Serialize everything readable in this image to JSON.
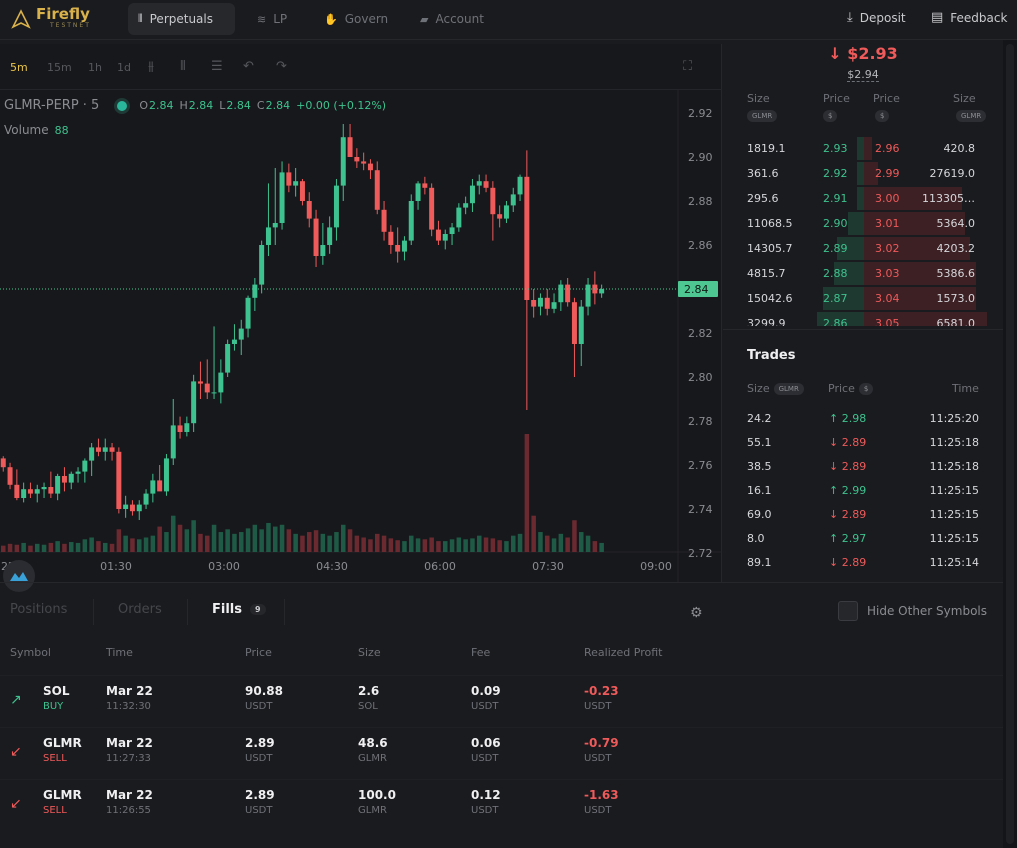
{
  "brand": {
    "name": "Firefly",
    "sub": "TESTNET"
  },
  "nav": {
    "items": [
      {
        "label": "Perpetuals",
        "icon": "candles-icon",
        "active": true
      },
      {
        "label": "LP",
        "icon": "waves-icon",
        "active": false
      },
      {
        "label": "Govern",
        "icon": "hand-vote-icon",
        "active": false
      },
      {
        "label": "Account",
        "icon": "wallet-icon",
        "active": false
      }
    ]
  },
  "top_right": {
    "deposit": "Deposit",
    "feedback": "Feedback"
  },
  "toolbar": {
    "timeframes": [
      "5m",
      "15m",
      "1h",
      "1d"
    ],
    "active_timeframe": "5m"
  },
  "legend": {
    "symbol": "GLMR-PERP · 5",
    "o_label": "O",
    "o": "2.84",
    "h_label": "H",
    "h": "2.84",
    "l_label": "L",
    "l": "2.84",
    "c_label": "C",
    "c": "2.84",
    "change": "+0.00 (+0.12%)",
    "volume_label": "Volume",
    "volume": "88"
  },
  "price_axis": {
    "ticks": [
      "2.92",
      "2.90",
      "2.88",
      "2.86",
      "2.84",
      "2.82",
      "2.80",
      "2.78",
      "2.76",
      "2.74",
      "2.72"
    ],
    "current_price": "2.84"
  },
  "time_axis": {
    "ticks": [
      "22",
      "01:30",
      "03:00",
      "04:30",
      "06:00",
      "07:30",
      "09:00"
    ]
  },
  "chart_data": {
    "type": "candlestick",
    "symbol": "GLMR-PERP",
    "interval": "5m",
    "ylim": [
      2.715,
      2.925
    ],
    "current_price": 2.84,
    "x_ticks": [
      "22",
      "01:30",
      "03:00",
      "04:30",
      "06:00",
      "07:30",
      "09:00"
    ],
    "y_ticks": [
      2.92,
      2.9,
      2.88,
      2.86,
      2.84,
      2.82,
      2.8,
      2.78,
      2.76,
      2.74,
      2.72
    ],
    "candles": [
      [
        2.763,
        2.764,
        2.757,
        2.759
      ],
      [
        2.759,
        2.761,
        2.749,
        2.751
      ],
      [
        2.751,
        2.758,
        2.744,
        2.745
      ],
      [
        2.745,
        2.752,
        2.743,
        2.749
      ],
      [
        2.749,
        2.752,
        2.745,
        2.747
      ],
      [
        2.747,
        2.751,
        2.743,
        2.749
      ],
      [
        2.749,
        2.752,
        2.745,
        2.75
      ],
      [
        2.75,
        2.757,
        2.745,
        2.747
      ],
      [
        2.747,
        2.756,
        2.744,
        2.755
      ],
      [
        2.755,
        2.759,
        2.748,
        2.752
      ],
      [
        2.752,
        2.757,
        2.749,
        2.756
      ],
      [
        2.756,
        2.759,
        2.752,
        2.757
      ],
      [
        2.757,
        2.763,
        2.752,
        2.762
      ],
      [
        2.762,
        2.77,
        2.755,
        2.768
      ],
      [
        2.768,
        2.772,
        2.764,
        2.766
      ],
      [
        2.766,
        2.772,
        2.762,
        2.768
      ],
      [
        2.768,
        2.77,
        2.762,
        2.766
      ],
      [
        2.766,
        2.768,
        2.738,
        2.74
      ],
      [
        2.74,
        2.746,
        2.736,
        2.742
      ],
      [
        2.742,
        2.744,
        2.737,
        2.739
      ],
      [
        2.739,
        2.744,
        2.735,
        2.742
      ],
      [
        2.742,
        2.749,
        2.74,
        2.747
      ],
      [
        2.747,
        2.756,
        2.743,
        2.753
      ],
      [
        2.753,
        2.76,
        2.75,
        2.748
      ],
      [
        2.748,
        2.765,
        2.746,
        2.763
      ],
      [
        2.763,
        2.79,
        2.76,
        2.778
      ],
      [
        2.778,
        2.782,
        2.772,
        2.775
      ],
      [
        2.775,
        2.782,
        2.773,
        2.779
      ],
      [
        2.779,
        2.801,
        2.775,
        2.798
      ],
      [
        2.798,
        2.807,
        2.79,
        2.797
      ],
      [
        2.797,
        2.808,
        2.79,
        2.793
      ],
      [
        2.793,
        2.823,
        2.79,
        2.793
      ],
      [
        2.793,
        2.808,
        2.788,
        2.802
      ],
      [
        2.802,
        2.817,
        2.8,
        2.815
      ],
      [
        2.815,
        2.824,
        2.812,
        2.817
      ],
      [
        2.817,
        2.826,
        2.81,
        2.822
      ],
      [
        2.822,
        2.837,
        2.818,
        2.836
      ],
      [
        2.836,
        2.845,
        2.83,
        2.842
      ],
      [
        2.842,
        2.862,
        2.838,
        2.86
      ],
      [
        2.86,
        2.888,
        2.855,
        2.868
      ],
      [
        2.868,
        2.895,
        2.86,
        2.87
      ],
      [
        2.87,
        2.898,
        2.867,
        2.893
      ],
      [
        2.893,
        2.897,
        2.884,
        2.887
      ],
      [
        2.887,
        2.895,
        2.882,
        2.889
      ],
      [
        2.889,
        2.89,
        2.878,
        2.88
      ],
      [
        2.88,
        2.884,
        2.868,
        2.872
      ],
      [
        2.872,
        2.876,
        2.85,
        2.855
      ],
      [
        2.855,
        2.87,
        2.851,
        2.86
      ],
      [
        2.86,
        2.873,
        2.856,
        2.868
      ],
      [
        2.868,
        2.89,
        2.862,
        2.887
      ],
      [
        2.887,
        2.915,
        2.88,
        2.909
      ],
      [
        2.909,
        2.915,
        2.902,
        2.9
      ],
      [
        2.9,
        2.904,
        2.895,
        2.898
      ],
      [
        2.898,
        2.902,
        2.894,
        2.897
      ],
      [
        2.897,
        2.899,
        2.89,
        2.894
      ],
      [
        2.894,
        2.898,
        2.874,
        2.876
      ],
      [
        2.876,
        2.88,
        2.862,
        2.866
      ],
      [
        2.866,
        2.869,
        2.856,
        2.86
      ],
      [
        2.86,
        2.868,
        2.852,
        2.857
      ],
      [
        2.857,
        2.864,
        2.853,
        2.862
      ],
      [
        2.862,
        2.883,
        2.86,
        2.88
      ],
      [
        2.88,
        2.889,
        2.876,
        2.888
      ],
      [
        2.888,
        2.891,
        2.883,
        2.886
      ],
      [
        2.886,
        2.888,
        2.864,
        2.867
      ],
      [
        2.867,
        2.871,
        2.86,
        2.862
      ],
      [
        2.862,
        2.867,
        2.858,
        2.865
      ],
      [
        2.865,
        2.87,
        2.86,
        2.868
      ],
      [
        2.868,
        2.879,
        2.866,
        2.877
      ],
      [
        2.877,
        2.882,
        2.874,
        2.879
      ],
      [
        2.879,
        2.89,
        2.875,
        2.887
      ],
      [
        2.887,
        2.892,
        2.883,
        2.889
      ],
      [
        2.889,
        2.892,
        2.884,
        2.886
      ],
      [
        2.886,
        2.889,
        2.862,
        2.874
      ],
      [
        2.874,
        2.878,
        2.868,
        2.872
      ],
      [
        2.872,
        2.88,
        2.87,
        2.878
      ],
      [
        2.878,
        2.886,
        2.875,
        2.883
      ],
      [
        2.883,
        2.892,
        2.88,
        2.891
      ],
      [
        2.891,
        2.903,
        2.785,
        2.835
      ],
      [
        2.835,
        2.84,
        2.827,
        2.832
      ],
      [
        2.832,
        2.838,
        2.828,
        2.836
      ],
      [
        2.836,
        2.84,
        2.828,
        2.831
      ],
      [
        2.831,
        2.838,
        2.829,
        2.834
      ],
      [
        2.834,
        2.844,
        2.83,
        2.842
      ],
      [
        2.842,
        2.845,
        2.832,
        2.834
      ],
      [
        2.834,
        2.836,
        2.8,
        2.815
      ],
      [
        2.815,
        2.835,
        2.805,
        2.832
      ],
      [
        2.832,
        2.845,
        2.828,
        2.842
      ],
      [
        2.842,
        2.848,
        2.833,
        2.838
      ],
      [
        2.838,
        2.842,
        2.836,
        2.84
      ]
    ],
    "volume": [
      7,
      9,
      8,
      10,
      7,
      9,
      8,
      10,
      12,
      9,
      11,
      10,
      14,
      16,
      12,
      10,
      9,
      25,
      18,
      15,
      14,
      16,
      18,
      28,
      22,
      40,
      30,
      25,
      35,
      20,
      18,
      30,
      22,
      25,
      20,
      22,
      26,
      30,
      25,
      32,
      28,
      30,
      25,
      20,
      18,
      22,
      24,
      20,
      18,
      22,
      30,
      25,
      18,
      16,
      14,
      20,
      18,
      15,
      13,
      12,
      18,
      15,
      14,
      16,
      12,
      12,
      14,
      16,
      14,
      15,
      18,
      16,
      15,
      13,
      12,
      18,
      20,
      130,
      40,
      22,
      18,
      15,
      20,
      16,
      35,
      22,
      18,
      12,
      10
    ]
  },
  "orderbook": {
    "mark_price": "$2.93",
    "index_price": "$2.94",
    "headers": {
      "size_left": "Size",
      "price_left": "Price",
      "price_right": "Price",
      "size_right": "Size",
      "pill_size_left": "GLMR",
      "pill_price_left": "$",
      "pill_price_right": "$",
      "pill_size_right": "GLMR"
    },
    "rows": [
      {
        "bid_size": "1819.1",
        "bid_price": "2.93",
        "ask_price": "2.96",
        "ask_size": "420.8",
        "bid_depth": 0.03,
        "ask_depth": 0.03
      },
      {
        "bid_size": "361.6",
        "bid_price": "2.92",
        "ask_price": "2.99",
        "ask_size": "27619.0",
        "bid_depth": 0.03,
        "ask_depth": 0.05
      },
      {
        "bid_size": "295.6",
        "bid_price": "2.91",
        "ask_price": "3.00",
        "ask_size": "113305…",
        "bid_depth": 0.03,
        "ask_depth": 0.35
      },
      {
        "bid_size": "11068.5",
        "bid_price": "2.90",
        "ask_price": "3.01",
        "ask_size": "5364.0",
        "bid_depth": 0.06,
        "ask_depth": 0.36
      },
      {
        "bid_size": "14305.7",
        "bid_price": "2.89",
        "ask_price": "3.02",
        "ask_size": "4203.2",
        "bid_depth": 0.1,
        "ask_depth": 0.38
      },
      {
        "bid_size": "4815.7",
        "bid_price": "2.88",
        "ask_price": "3.03",
        "ask_size": "5386.6",
        "bid_depth": 0.11,
        "ask_depth": 0.4
      },
      {
        "bid_size": "15042.6",
        "bid_price": "2.87",
        "ask_price": "3.04",
        "ask_size": "1573.0",
        "bid_depth": 0.15,
        "ask_depth": 0.4
      },
      {
        "bid_size": "3299.9",
        "bid_price": "2.86",
        "ask_price": "3.05",
        "ask_size": "6581.0",
        "bid_depth": 0.17,
        "ask_depth": 0.44
      }
    ]
  },
  "trades": {
    "title": "Trades",
    "headers": {
      "size": "Size",
      "size_unit": "GLMR",
      "price": "Price",
      "price_unit": "$",
      "time": "Time"
    },
    "rows": [
      {
        "size": "24.2",
        "price": "2.98",
        "dir": "up",
        "time": "11:25:20"
      },
      {
        "size": "55.1",
        "price": "2.89",
        "dir": "down",
        "time": "11:25:18"
      },
      {
        "size": "38.5",
        "price": "2.89",
        "dir": "down",
        "time": "11:25:18"
      },
      {
        "size": "16.1",
        "price": "2.99",
        "dir": "up",
        "time": "11:25:15"
      },
      {
        "size": "69.0",
        "price": "2.89",
        "dir": "down",
        "time": "11:25:15"
      },
      {
        "size": "8.0",
        "price": "2.97",
        "dir": "up",
        "time": "11:25:15"
      },
      {
        "size": "89.1",
        "price": "2.89",
        "dir": "down",
        "time": "11:25:14"
      }
    ]
  },
  "bottom": {
    "tabs": {
      "positions": "Positions",
      "orders": "Orders",
      "fills": "Fills",
      "fills_count": "9"
    },
    "hide_other_symbols": "Hide Other Symbols",
    "columns": {
      "symbol": "Symbol",
      "time": "Time",
      "price": "Price",
      "size": "Size",
      "fee": "Fee",
      "realized_profit": "Realized Profit"
    },
    "fills": [
      {
        "symbol": "SOL",
        "side": "BUY",
        "date": "Mar 22",
        "time": "11:32:30",
        "price": "90.88",
        "price_unit": "USDT",
        "size": "2.6",
        "size_unit": "SOL",
        "fee": "0.09",
        "fee_unit": "USDT",
        "profit": "-0.23",
        "profit_unit": "USDT"
      },
      {
        "symbol": "GLMR",
        "side": "SELL",
        "date": "Mar 22",
        "time": "11:27:33",
        "price": "2.89",
        "price_unit": "USDT",
        "size": "48.6",
        "size_unit": "GLMR",
        "fee": "0.06",
        "fee_unit": "USDT",
        "profit": "-0.79",
        "profit_unit": "USDT"
      },
      {
        "symbol": "GLMR",
        "side": "SELL",
        "date": "Mar 22",
        "time": "11:26:55",
        "price": "2.89",
        "price_unit": "USDT",
        "size": "100.0",
        "size_unit": "GLMR",
        "fee": "0.12",
        "fee_unit": "USDT",
        "profit": "-1.63",
        "profit_unit": "USDT"
      }
    ]
  },
  "colors": {
    "up": "#3ec28f",
    "down": "#ef5a5a",
    "up_vol": "#1e5a45",
    "down_vol": "#6a2a30",
    "accent": "#e8c34a",
    "price_tag": "#4ec792"
  }
}
